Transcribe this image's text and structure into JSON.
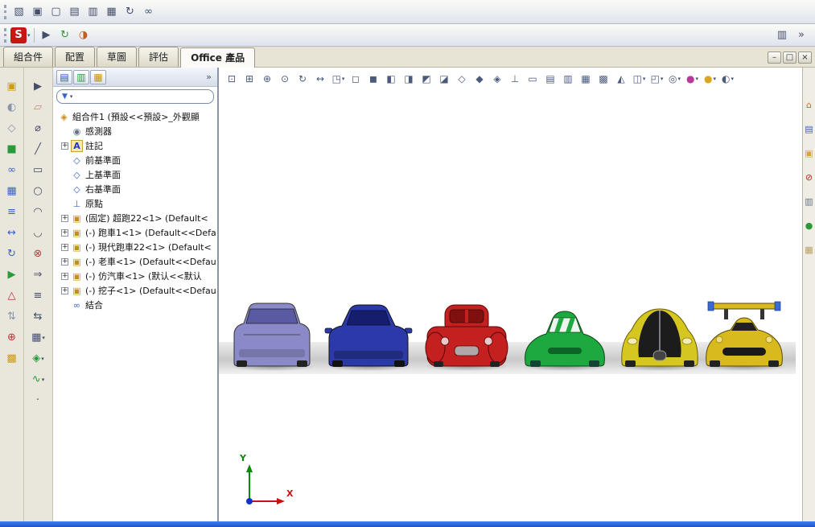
{
  "toolbar_top": {
    "icons": [
      {
        "name": "view-image",
        "glyph": "▧"
      },
      {
        "name": "screen-capture",
        "glyph": "▣"
      },
      {
        "name": "new-window",
        "glyph": "▢"
      },
      {
        "name": "cascade-windows",
        "glyph": "▤"
      },
      {
        "name": "tile-windows",
        "glyph": "▥"
      },
      {
        "name": "open-recent",
        "glyph": "▦"
      },
      {
        "name": "refresh-view",
        "glyph": "↻"
      },
      {
        "name": "hyperlink",
        "glyph": "∞"
      }
    ]
  },
  "toolbar_main": {
    "logo": "S",
    "logo_arrow": "▾",
    "icons": [
      {
        "name": "select-tool",
        "glyph": "▶",
        "color": "#44506a"
      },
      {
        "name": "rebuild",
        "glyph": "↻",
        "color": "#2a9a3a"
      },
      {
        "name": "appearance-color",
        "glyph": "◑",
        "color": "#c06020"
      }
    ],
    "right_icons": [
      {
        "name": "task-pane-toggle",
        "glyph": "▥"
      },
      {
        "name": "toolbar-overflow",
        "glyph": "»"
      }
    ]
  },
  "command_tabs": [
    {
      "name": "tab-assembly",
      "label": "組合件"
    },
    {
      "name": "tab-layout",
      "label": "配置"
    },
    {
      "name": "tab-sketch",
      "label": "草圖"
    },
    {
      "name": "tab-evaluate",
      "label": "評估"
    },
    {
      "name": "tab-office-products",
      "label": "Office 產品",
      "active": true
    }
  ],
  "window_controls": {
    "minimize": "–",
    "restore": "□",
    "close": "×"
  },
  "assembly_toolbar": [
    {
      "name": "insert-component",
      "glyph": "▣",
      "color": "#d09a14"
    },
    {
      "name": "hide-show-component",
      "glyph": "◐",
      "color": "#8a96a8"
    },
    {
      "name": "change-transparency",
      "glyph": "◇",
      "color": "#8a96a8"
    },
    {
      "name": "edit-component",
      "glyph": "■",
      "color": "#2a9a3a"
    },
    {
      "name": "mate",
      "glyph": "∞",
      "color": "#3a62c8"
    },
    {
      "name": "linear-component-pattern",
      "glyph": "▦",
      "color": "#3a62c8"
    },
    {
      "name": "smart-fasteners",
      "glyph": "≡",
      "color": "#3a62c8"
    },
    {
      "name": "move-component",
      "glyph": "↔",
      "color": "#3a62c8"
    },
    {
      "name": "rotate-component",
      "glyph": "↻",
      "color": "#3a62c8"
    },
    {
      "name": "new-motion-study",
      "glyph": "▶",
      "color": "#2a9a3a"
    },
    {
      "name": "exploded-view",
      "glyph": "△",
      "color": "#c03030"
    },
    {
      "name": "explode-line-sketch",
      "glyph": "⇅",
      "color": "#8a96a8"
    },
    {
      "name": "interference-detection",
      "glyph": "⊕",
      "color": "#c03030"
    },
    {
      "name": "assembly-features",
      "glyph": "▩",
      "color": "#d09a14"
    }
  ],
  "tools_toolbar": [
    {
      "name": "select",
      "glyph": "▶",
      "color": "#44506a"
    },
    {
      "name": "sketch",
      "glyph": "▱",
      "color": "#d09a14"
    },
    {
      "name": "smart-dimension",
      "glyph": "⌀",
      "color": "#44506a"
    },
    {
      "name": "line",
      "glyph": "╱",
      "color": "#44506a"
    },
    {
      "name": "corner-rectangle",
      "glyph": "▭",
      "color": "#44506a"
    },
    {
      "name": "circle",
      "glyph": "○",
      "color": "#44506a"
    },
    {
      "name": "centerpoint-arc",
      "glyph": "◠",
      "color": "#44506a"
    },
    {
      "name": "sketch-fillet",
      "glyph": "◡",
      "color": "#44506a"
    },
    {
      "name": "trim-entities",
      "glyph": "⊗",
      "color": "#b04040"
    },
    {
      "name": "convert-entities",
      "glyph": "⇒",
      "color": "#44506a"
    },
    {
      "name": "offset-entities",
      "glyph": "≡",
      "color": "#44506a"
    },
    {
      "name": "mirror-entities",
      "glyph": "⇆",
      "color": "#44506a"
    },
    {
      "name": "linear-sketch-pattern",
      "glyph": "▦",
      "color": "#44506a",
      "arrow": "▾"
    },
    {
      "name": "display-relations",
      "glyph": "◈",
      "color": "#2a9a3a",
      "arrow": "▾"
    },
    {
      "name": "spline",
      "glyph": "∿",
      "color": "#2a9a3a",
      "arrow": "▾"
    },
    {
      "name": "sketch-point",
      "glyph": "·",
      "color": "#44506a"
    }
  ],
  "tree_panel": {
    "tabs": [
      {
        "name": "featuremanager-tree-tab",
        "glyph": "▤",
        "color": "#2a52b8"
      },
      {
        "name": "propertymanager-tab",
        "glyph": "▥",
        "color": "#2a9a3a"
      },
      {
        "name": "configurationmanager-tab",
        "glyph": "▦",
        "color": "#c89010"
      }
    ],
    "overflow": "»",
    "filter": {
      "funnel": "▼",
      "arrow": "▾"
    },
    "root": {
      "label": "組合件1 (預設<<預設>_外觀顯"
    },
    "items": [
      {
        "name": "tree-item-sensors",
        "icon": "sensors",
        "label": "感測器"
      },
      {
        "name": "tree-item-annotations",
        "icon": "annotations",
        "label": "註記",
        "expand": "plus"
      },
      {
        "name": "tree-item-front-plane",
        "icon": "plane",
        "label": "前基準面"
      },
      {
        "name": "tree-item-top-plane",
        "icon": "plane",
        "label": "上基準面"
      },
      {
        "name": "tree-item-right-plane",
        "icon": "plane",
        "label": "右基準面"
      },
      {
        "name": "tree-item-origin",
        "icon": "origin",
        "label": "原點"
      },
      {
        "name": "tree-item-supercar22",
        "icon": "component-fixed",
        "label": "(固定) 超跑22<1> (Default<",
        "expand": "plus"
      },
      {
        "name": "tree-item-sportscar1",
        "icon": "component",
        "label": "(-) 跑車1<1> (Default<<Defa",
        "expand": "plus"
      },
      {
        "name": "tree-item-modern-car22",
        "icon": "component",
        "label": "(-) 現代跑車22<1> (Default<",
        "expand": "plus"
      },
      {
        "name": "tree-item-old-car",
        "icon": "component",
        "label": "(-) 老車<1> (Default<<Defau",
        "expand": "plus"
      },
      {
        "name": "tree-item-replica-car",
        "icon": "component",
        "label": "(-) 仿汽車<1> (默认<<默认",
        "expand": "plus"
      },
      {
        "name": "tree-item-digger",
        "icon": "component",
        "label": "(-) 挖子<1> (Default<<Defau",
        "expand": "plus"
      },
      {
        "name": "tree-item-mates",
        "icon": "mates",
        "label": "結合"
      }
    ]
  },
  "heads_up": [
    {
      "name": "zoom-to-fit",
      "glyph": "⊡"
    },
    {
      "name": "zoom-to-area",
      "glyph": "⊞"
    },
    {
      "name": "zoom-in-out",
      "glyph": "⊕"
    },
    {
      "name": "zoom-to-selection",
      "glyph": "⊙"
    },
    {
      "name": "rotate-view",
      "glyph": "↻"
    },
    {
      "name": "pan",
      "glyph": "↔"
    },
    {
      "name": "3d-drawing-view",
      "glyph": "◳",
      "arrow": "▾"
    },
    {
      "name": "front-view",
      "glyph": "◻"
    },
    {
      "name": "back-view",
      "glyph": "◼"
    },
    {
      "name": "left-view",
      "glyph": "◧"
    },
    {
      "name": "right-view",
      "glyph": "◨"
    },
    {
      "name": "top-view",
      "glyph": "◩"
    },
    {
      "name": "bottom-view",
      "glyph": "◪"
    },
    {
      "name": "isometric-view",
      "glyph": "◇"
    },
    {
      "name": "dimetric-view",
      "glyph": "◆"
    },
    {
      "name": "trimetric-view",
      "glyph": "◈"
    },
    {
      "name": "normal-to",
      "glyph": "⊥"
    },
    {
      "name": "wireframe",
      "glyph": "▭"
    },
    {
      "name": "hidden-lines-visible",
      "glyph": "▤"
    },
    {
      "name": "hidden-lines-removed",
      "glyph": "▥"
    },
    {
      "name": "shaded-with-edges",
      "glyph": "▦"
    },
    {
      "name": "shaded",
      "glyph": "▩"
    },
    {
      "name": "section-view",
      "glyph": "◭"
    },
    {
      "name": "view-orientation",
      "glyph": "◫",
      "arrow": "▾"
    },
    {
      "name": "display-style",
      "glyph": "◰",
      "arrow": "▾"
    },
    {
      "name": "hide-show-items",
      "glyph": "◎",
      "arrow": "▾"
    },
    {
      "name": "edit-appearance",
      "glyph": "●",
      "color": "#b8399a",
      "arrow": "▾"
    },
    {
      "name": "apply-scene",
      "glyph": "●",
      "color": "#dca61a",
      "arrow": "▾"
    },
    {
      "name": "view-settings",
      "glyph": "◐",
      "arrow": "▾"
    }
  ],
  "task_pane": [
    {
      "name": "solidworks-resources",
      "glyph": "⌂",
      "color": "#c86a14"
    },
    {
      "name": "design-library",
      "glyph": "▤",
      "color": "#3a62c8"
    },
    {
      "name": "file-explorer",
      "glyph": "▣",
      "color": "#d9a820"
    },
    {
      "name": "solidworks-search",
      "glyph": "⊘",
      "color": "#c02222"
    },
    {
      "name": "view-palette",
      "glyph": "▥",
      "color": "#667488"
    },
    {
      "name": "appearances-scenes",
      "glyph": "●",
      "color": "#2a9a3a"
    },
    {
      "name": "custom-properties",
      "glyph": "▦",
      "color": "#b8a060"
    }
  ],
  "triad": {
    "y_label": "Y",
    "x_label": "X"
  },
  "cars": [
    {
      "body": "#8a8ac8",
      "window": "#5a5aa2"
    },
    {
      "body": "#2b3aa8",
      "window": "#141e6a"
    },
    {
      "body": "#c42020",
      "window": "#801010"
    },
    {
      "body": "#1ea840",
      "window": "#edf6ee"
    },
    {
      "body": "#d6c620",
      "window": "#1c1c1c"
    },
    {
      "body": "#d8ba1e",
      "window": "#202020"
    }
  ]
}
